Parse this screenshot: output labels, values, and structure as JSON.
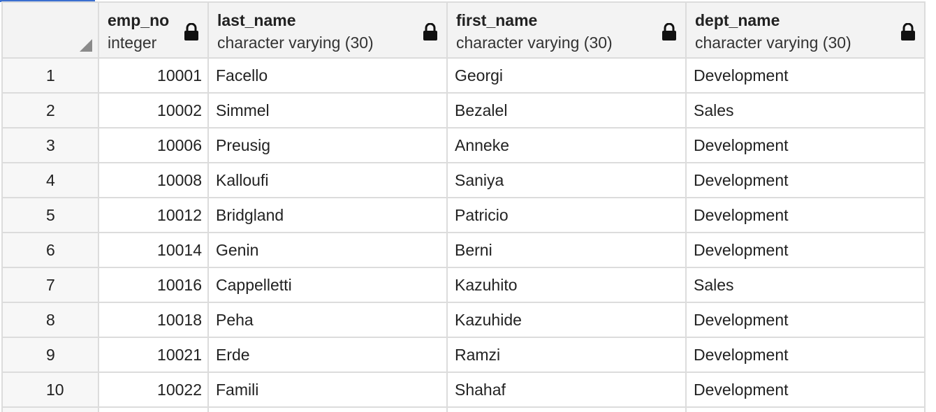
{
  "grid": {
    "columns": [
      {
        "name": "emp_no",
        "type": "integer",
        "icon": "lock-icon"
      },
      {
        "name": "last_name",
        "type": "character varying (30)",
        "icon": "lock-icon"
      },
      {
        "name": "first_name",
        "type": "character varying (30)",
        "icon": "lock-icon"
      },
      {
        "name": "dept_name",
        "type": "character varying (30)",
        "icon": "lock-icon"
      }
    ],
    "rows": [
      {
        "n": "1",
        "emp_no": "10001",
        "last_name": "Facello",
        "first_name": "Georgi",
        "dept_name": "Development"
      },
      {
        "n": "2",
        "emp_no": "10002",
        "last_name": "Simmel",
        "first_name": "Bezalel",
        "dept_name": "Sales"
      },
      {
        "n": "3",
        "emp_no": "10006",
        "last_name": "Preusig",
        "first_name": "Anneke",
        "dept_name": "Development"
      },
      {
        "n": "4",
        "emp_no": "10008",
        "last_name": "Kalloufi",
        "first_name": "Saniya",
        "dept_name": "Development"
      },
      {
        "n": "5",
        "emp_no": "10012",
        "last_name": "Bridgland",
        "first_name": "Patricio",
        "dept_name": "Development"
      },
      {
        "n": "6",
        "emp_no": "10014",
        "last_name": "Genin",
        "first_name": "Berni",
        "dept_name": "Development"
      },
      {
        "n": "7",
        "emp_no": "10016",
        "last_name": "Cappelletti",
        "first_name": "Kazuhito",
        "dept_name": "Sales"
      },
      {
        "n": "8",
        "emp_no": "10018",
        "last_name": "Peha",
        "first_name": "Kazuhide",
        "dept_name": "Development"
      },
      {
        "n": "9",
        "emp_no": "10021",
        "last_name": "Erde",
        "first_name": "Ramzi",
        "dept_name": "Development"
      },
      {
        "n": "10",
        "emp_no": "10022",
        "last_name": "Famili",
        "first_name": "Shahaf",
        "dept_name": "Development"
      }
    ]
  },
  "colors": {
    "accent": "#3a6fd0",
    "header_bg": "#f3f3f3",
    "grid_line": "#dcdcdc"
  }
}
